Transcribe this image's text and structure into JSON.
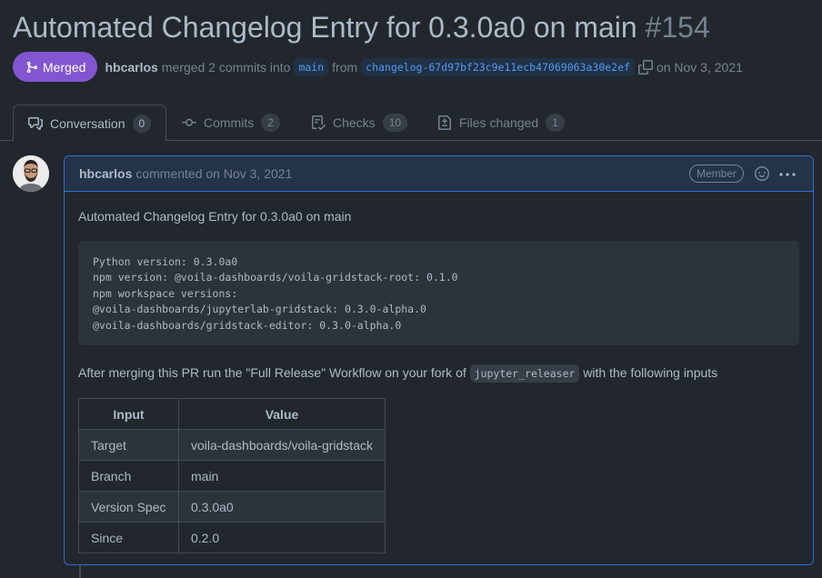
{
  "pr": {
    "title": "Automated Changelog Entry for 0.3.0a0 on main",
    "number": "#154"
  },
  "meta": {
    "status": "Merged",
    "author": "hbcarlos",
    "action_text": "merged 2 commits into",
    "base_branch": "main",
    "from_text": "from",
    "head_branch": "changelog-67d97bf23c9e11ecb47069063a30e2ef",
    "date_text": "on Nov 3, 2021",
    "status_color": "#8256d0"
  },
  "tabs": [
    {
      "label": "Conversation",
      "count": "0",
      "icon": "comment-discussion-icon"
    },
    {
      "label": "Commits",
      "count": "2",
      "icon": "git-commit-icon"
    },
    {
      "label": "Checks",
      "count": "10",
      "icon": "checklist-icon"
    },
    {
      "label": "Files changed",
      "count": "1",
      "icon": "file-diff-icon"
    }
  ],
  "comment": {
    "author": "hbcarlos",
    "commented_text": "commented on Nov 3, 2021",
    "badge": "Member",
    "body_intro": "Automated Changelog Entry for 0.3.0a0 on main",
    "code_block": "Python version: 0.3.0a0\nnpm version: @voila-dashboards/voila-gridstack-root: 0.1.0\nnpm workspace versions:\n@voila-dashboards/jupyterlab-gridstack: 0.3.0-alpha.0\n@voila-dashboards/gridstack-editor: 0.3.0-alpha.0",
    "after_text_1": "After merging this PR run the \"Full Release\" Workflow on your fork of",
    "after_code": "jupyter_releaser",
    "after_text_2": "with the following inputs",
    "table": {
      "headers": [
        "Input",
        "Value"
      ],
      "rows": [
        [
          "Target",
          "voila-dashboards/voila-gridstack"
        ],
        [
          "Branch",
          "main"
        ],
        [
          "Version Spec",
          "0.3.0a0"
        ],
        [
          "Since",
          "0.2.0"
        ]
      ]
    }
  }
}
